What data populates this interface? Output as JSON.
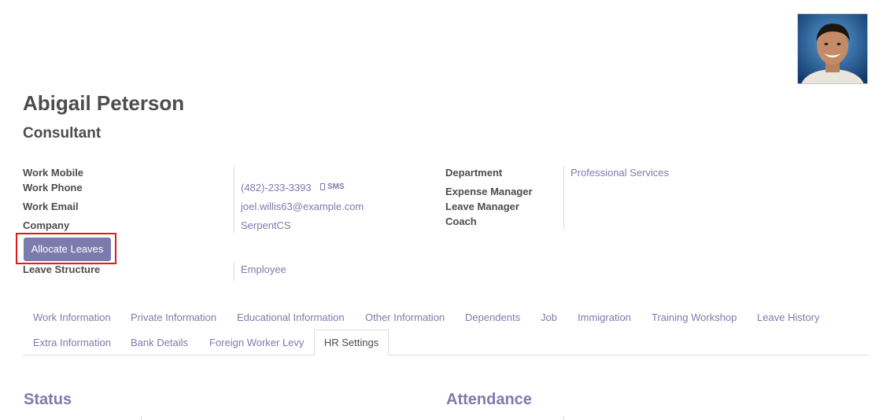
{
  "employee": {
    "name": "Abigail Peterson",
    "job_title": "Consultant",
    "avatar_icon": "employee-photo"
  },
  "left_fields": {
    "work_mobile": {
      "label": "Work Mobile",
      "value": ""
    },
    "work_phone": {
      "label": "Work Phone",
      "value": "(482)-233-3393",
      "sms_label": "SMS"
    },
    "work_email": {
      "label": "Work Email",
      "value": "joel.willis63@example.com"
    },
    "company": {
      "label": "Company",
      "value": "SerpentCS"
    },
    "leave_structure": {
      "label": "Leave Structure",
      "value": "Employee"
    }
  },
  "right_fields": {
    "department": {
      "label": "Department",
      "value": "Professional Services"
    },
    "expense_manager": {
      "label": "Expense Manager",
      "value": ""
    },
    "leave_manager": {
      "label": "Leave Manager",
      "value": ""
    },
    "coach": {
      "label": "Coach",
      "value": ""
    }
  },
  "actions": {
    "allocate_leaves": "Allocate Leaves"
  },
  "tabs": {
    "row1": [
      "Work Information",
      "Private Information",
      "Educational Information",
      "Other Information",
      "Dependents",
      "Job",
      "Immigration",
      "Training Workshop",
      "Leave History"
    ],
    "row2": [
      "Extra Information",
      "Bank Details",
      "Foreign Worker Levy",
      "HR Settings"
    ],
    "active": "HR Settings"
  },
  "sections": {
    "status": "Status",
    "attendance": "Attendance"
  },
  "colors": {
    "accent": "#7c7bad",
    "text": "#4c4c4c",
    "highlight": "#e01b1b",
    "border": "#dcdcdc"
  }
}
